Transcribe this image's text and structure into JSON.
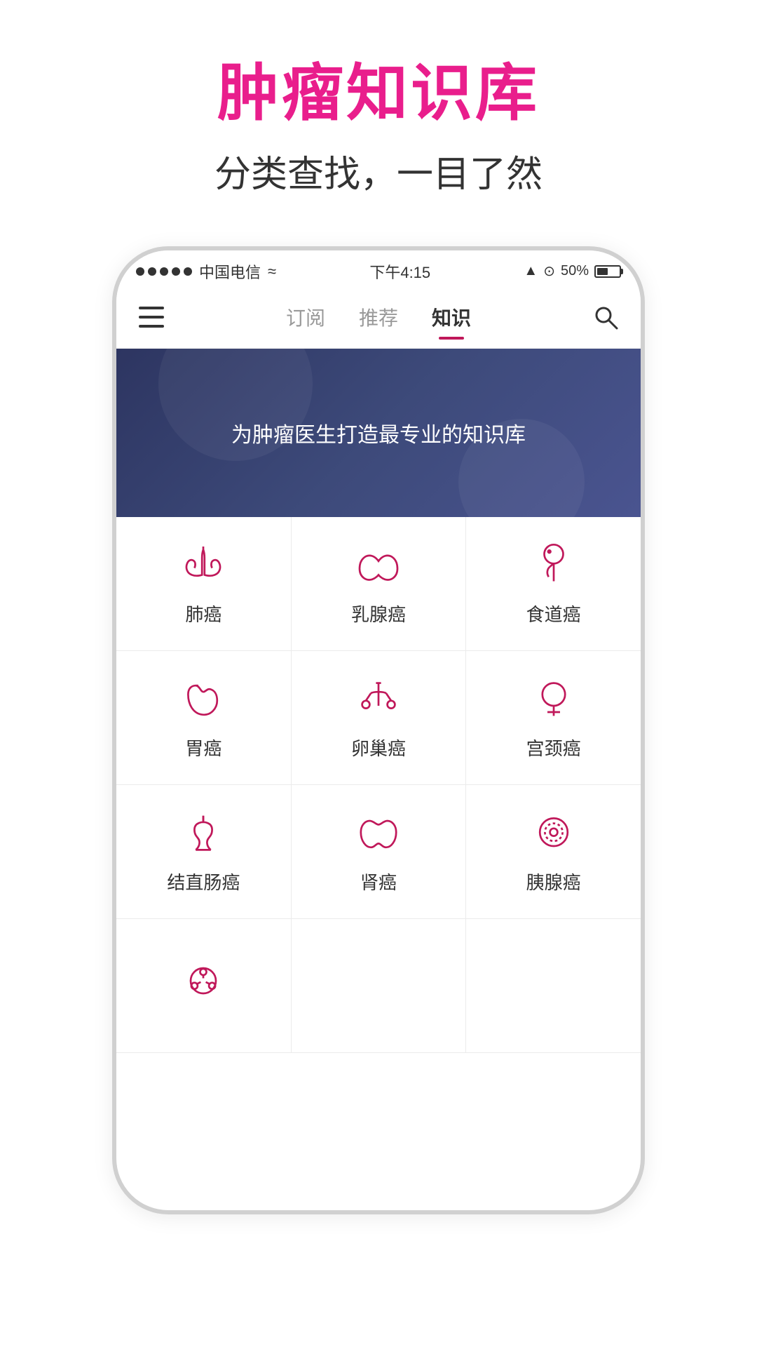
{
  "page": {
    "title_main": "肿瘤知识库",
    "title_sub": "分类查找，一目了然"
  },
  "status_bar": {
    "carrier": "中国电信",
    "wifi": "WiFi",
    "time": "下午4:15",
    "battery_pct": "50%",
    "location": "▲",
    "alarm": "⏰"
  },
  "nav": {
    "tabs": [
      {
        "label": "订阅",
        "active": false
      },
      {
        "label": "推荐",
        "active": false
      },
      {
        "label": "知识",
        "active": true
      }
    ],
    "menu_label": "☰",
    "search_label": "🔍"
  },
  "banner": {
    "text": "为肿瘤医生打造最专业的知识库"
  },
  "categories": [
    [
      {
        "id": "lung",
        "label": "肺癌",
        "icon": "lung"
      },
      {
        "id": "breast",
        "label": "乳腺癌",
        "icon": "breast"
      },
      {
        "id": "esophagus",
        "label": "食道癌",
        "icon": "esophagus"
      }
    ],
    [
      {
        "id": "stomach",
        "label": "胃癌",
        "icon": "stomach"
      },
      {
        "id": "ovary",
        "label": "卵巢癌",
        "icon": "ovary"
      },
      {
        "id": "cervix",
        "label": "宫颈癌",
        "icon": "cervix"
      }
    ],
    [
      {
        "id": "colon",
        "label": "结直肠癌",
        "icon": "colon"
      },
      {
        "id": "kidney",
        "label": "肾癌",
        "icon": "kidney"
      },
      {
        "id": "pancreas",
        "label": "胰腺癌",
        "icon": "pancreas"
      }
    ],
    [
      {
        "id": "lymphoma",
        "label": "",
        "icon": "lymphoma"
      },
      {
        "id": "empty2",
        "label": "",
        "icon": ""
      },
      {
        "id": "empty3",
        "label": "",
        "icon": ""
      }
    ]
  ]
}
